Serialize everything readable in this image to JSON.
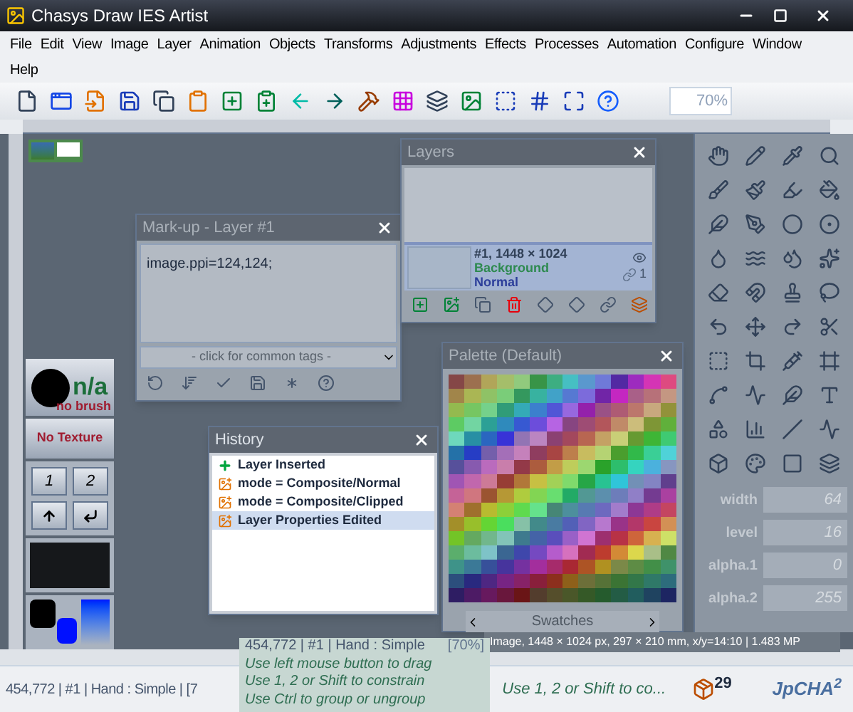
{
  "window": {
    "title": "Chasys Draw IES Artist"
  },
  "menu": [
    "File",
    "Edit",
    "View",
    "Image",
    "Layer",
    "Animation",
    "Objects",
    "Transforms",
    "Adjustments",
    "Effects",
    "Processes",
    "Automation",
    "Configure",
    "Window",
    "Help"
  ],
  "toolbar": {
    "zoom": "70%"
  },
  "brush": {
    "size": "n/a",
    "name": "no brush"
  },
  "texture": "No Texture",
  "keys": [
    "1",
    "2"
  ],
  "markup": {
    "title": "Mark-up - Layer #1",
    "code": "image.ppi=124,124;",
    "tags_placeholder": "- click for common tags -"
  },
  "layers": {
    "title": "Layers",
    "items": [
      {
        "info": "#1, 1448 × 1024",
        "name": "Background",
        "mode": "Normal",
        "link_count": "1",
        "selected": true
      }
    ]
  },
  "history": {
    "title": "History",
    "items": [
      {
        "label": "Layer Inserted",
        "kind": "insert",
        "selected": false
      },
      {
        "label": "mode = Composite/Normal",
        "kind": "edit",
        "selected": false
      },
      {
        "label": "mode = Composite/Clipped",
        "kind": "edit",
        "selected": false
      },
      {
        "label": "Layer Properties Edited",
        "kind": "edit",
        "selected": true
      }
    ]
  },
  "palette": {
    "title": "Palette (Default)",
    "footer": "Swatches"
  },
  "image_info": "Image, 1448 × 1024 px, 297 × 210 mm, x/y=14:10 | 1.483 MP",
  "toolbox": {
    "fields": [
      {
        "label": "width",
        "value": "64"
      },
      {
        "label": "level",
        "value": "16"
      },
      {
        "label": "alpha.1",
        "value": "0"
      },
      {
        "label": "alpha.2",
        "value": "255"
      }
    ]
  },
  "tooltip": {
    "header": "454,772 | #1 | Hand : Simple",
    "zoom": "[70%]",
    "lines": [
      "Use left mouse button to drag",
      "Use 1, 2 or Shift to constrain",
      "Use Ctrl to group or ungroup"
    ]
  },
  "status_bar": {
    "position": "454,772 | #1 | Hand : Simple | [7",
    "hint": "Use 1, 2 or Shift to co...",
    "count": "29",
    "badge": "JpCHA$^{2}$"
  }
}
